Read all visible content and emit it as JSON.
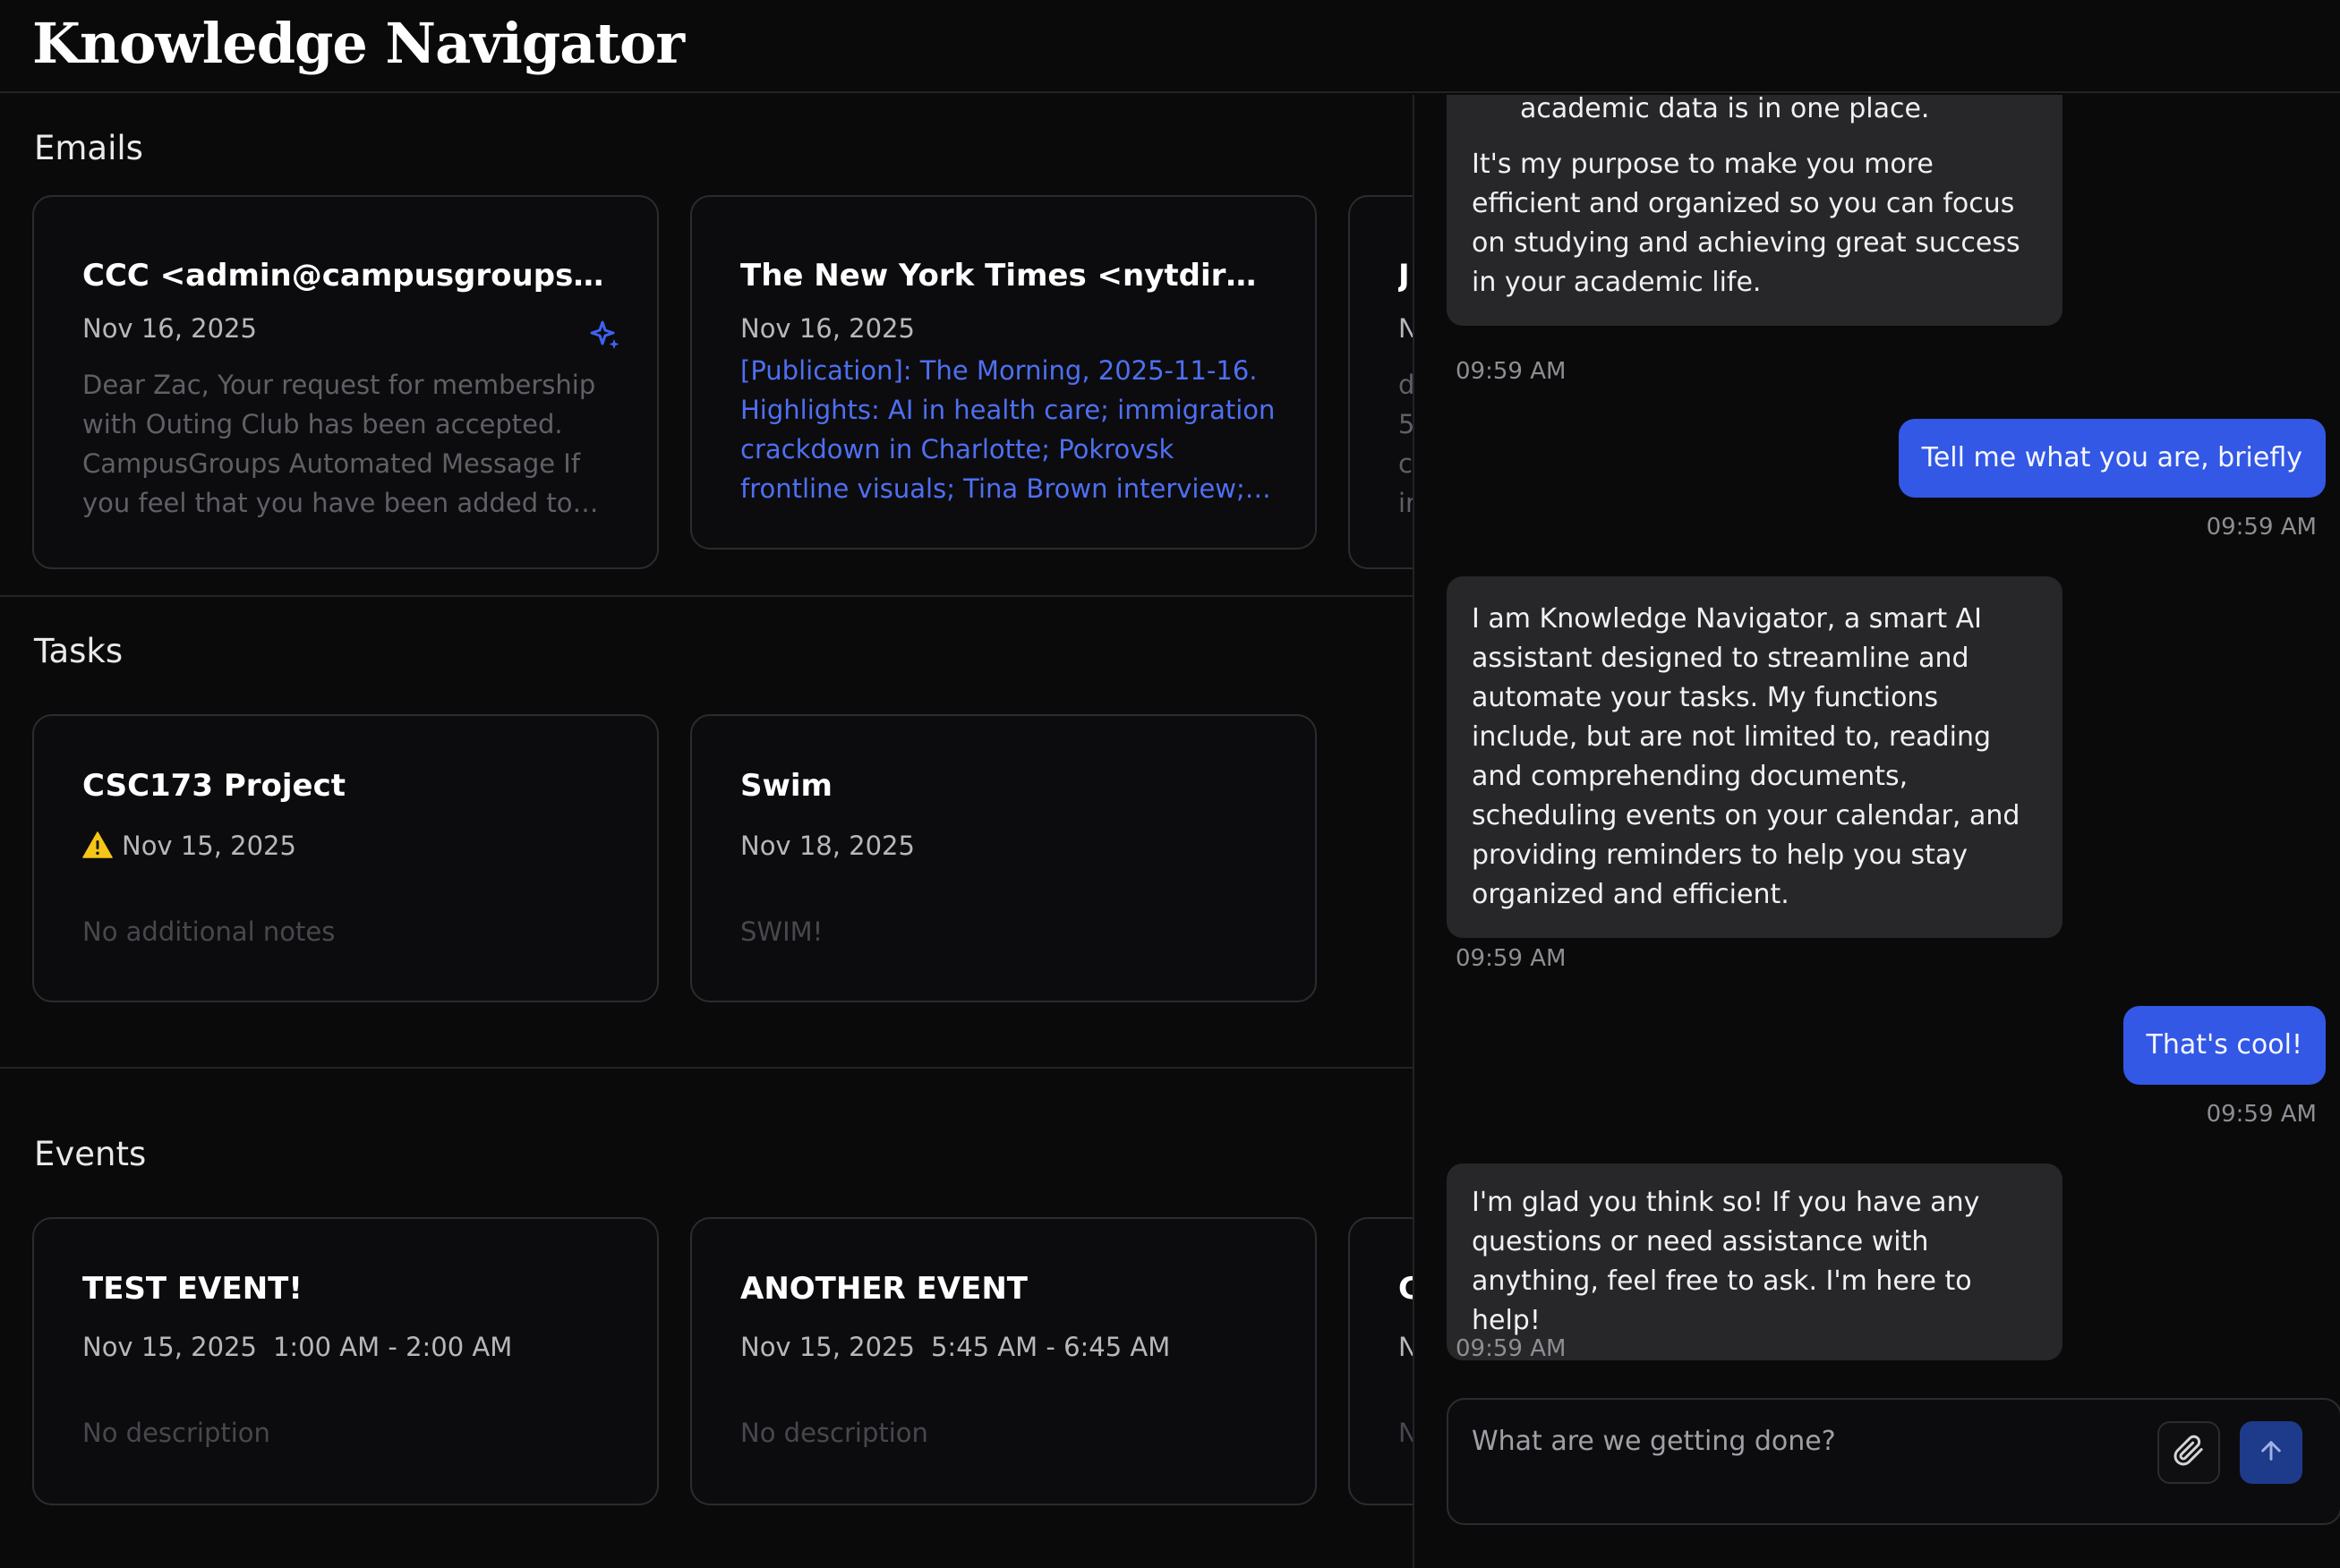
{
  "app": {
    "title": "Knowledge Navigator"
  },
  "emails": {
    "title": "Emails",
    "cards": [
      {
        "from": "CCC <admin@campusgroups.com>",
        "date": "Nov 16, 2025",
        "preview": "Dear Zac, Your request for membership with Outing Club has been accepted. CampusGroups Automated Message If you feel that you have been added to this group in error, please contact the group officers.",
        "icon": "sparkle-icon"
      },
      {
        "from": "The New York Times <nytdirect@nytimes.com>",
        "date": "Nov 16, 2025",
        "preview": "[Publication]: The Morning, 2025-11-16. Highlights: AI in health care; immigration crackdown in Charlotte; Pokrovsk frontline visuals; Tina Brown interview; and more."
      },
      {
        "from": "J",
        "date": "N",
        "preview": "d 5 c in"
      }
    ]
  },
  "tasks": {
    "title": "Tasks",
    "cards": [
      {
        "title": "CSC173 Project",
        "date": "Nov 15, 2025",
        "overdue_icon": "warning-icon",
        "notes": "No additional notes"
      },
      {
        "title": "Swim",
        "date": "Nov 18, 2025",
        "notes": "SWIM!"
      }
    ]
  },
  "events": {
    "title": "Events",
    "cards": [
      {
        "title": "TEST EVENT!",
        "date": "Nov 15, 2025",
        "time": "1:00 AM - 2:00 AM",
        "description": "No description"
      },
      {
        "title": "ANOTHER EVENT",
        "date": "Nov 15, 2025",
        "time": "5:45 AM - 6:45 AM",
        "description": "No description"
      },
      {
        "title": "C",
        "date": "N",
        "description": "N"
      }
    ]
  },
  "chat": {
    "messages": [
      {
        "role": "assistant",
        "partial_line": "academic data is in one place.",
        "text": "It's my purpose to make you more efficient and organized so you can focus on studying and achieving great success in your academic life.",
        "time": "09:59 AM"
      },
      {
        "role": "user",
        "text": "Tell me what you are, briefly",
        "time": "09:59 AM"
      },
      {
        "role": "assistant",
        "text": "I am Knowledge Navigator, a smart AI assistant designed to streamline and automate your tasks. My functions include, but are not limited to, reading and comprehending documents, scheduling events on your calendar, and providing reminders to help you stay organized and efficient.",
        "time": "09:59 AM"
      },
      {
        "role": "user",
        "text": "That's cool!",
        "time": "09:59 AM"
      },
      {
        "role": "assistant",
        "text": "I'm glad you think so! If you have any questions or need assistance with anything, feel free to ask. I'm here to help!",
        "time": "09:59 AM"
      }
    ],
    "composer": {
      "placeholder": "What are we getting done?",
      "attach_icon": "paperclip-icon",
      "send_icon": "arrow-up-icon"
    }
  },
  "colors": {
    "background": "#0a0a0b",
    "card_border": "#2b2c30",
    "accent": "#3358e6",
    "link": "#4f6ff2",
    "bot_bubble": "#27272a",
    "warning": "#f5c518"
  }
}
